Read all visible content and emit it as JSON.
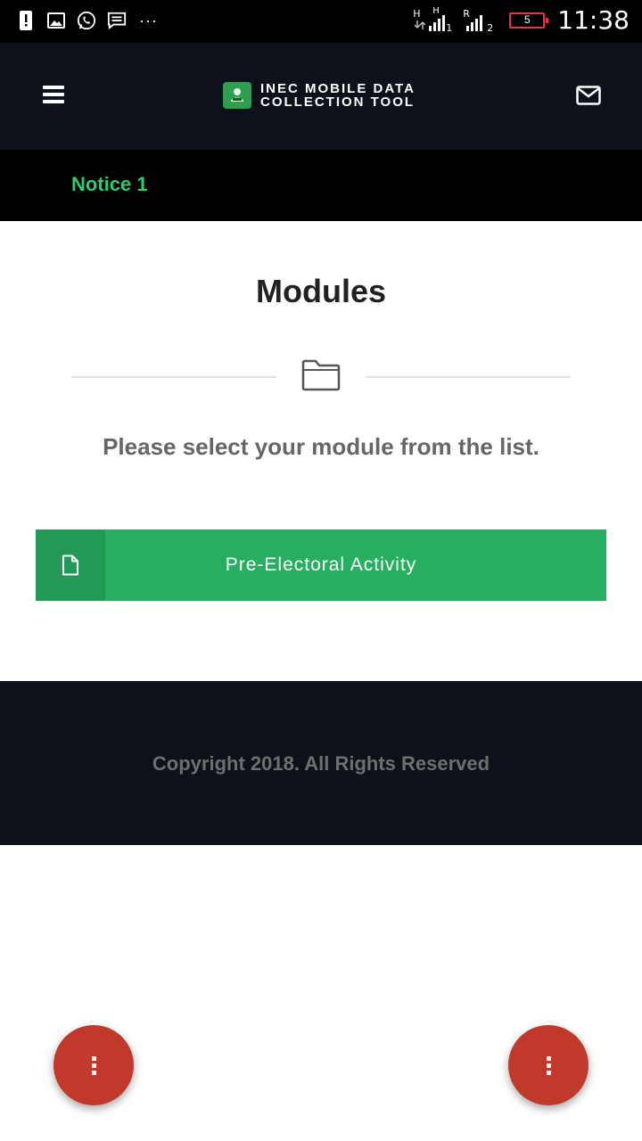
{
  "status_bar": {
    "time": "11:38",
    "battery_level": "5",
    "signal1_label_top": "H",
    "signal1_label_sub": "H",
    "signal1_slot": "1",
    "signal2_label_top": "R",
    "signal2_slot": "2",
    "overflow": "···",
    "icons": [
      "alert-icon",
      "image-icon",
      "whatsapp-icon",
      "message-icon"
    ]
  },
  "header": {
    "brand_line1": "INEC MOBILE DATA",
    "brand_line2": "COLLECTION TOOL",
    "menu_icon": "hamburger-icon",
    "mail_icon": "envelope-icon"
  },
  "notice": {
    "label": "Notice 1"
  },
  "main": {
    "title": "Modules",
    "divider_icon": "folder-icon",
    "subtitle": "Please select your module from the list.",
    "modules": [
      {
        "label": "Pre-Electoral Activity",
        "icon": "file-icon"
      }
    ]
  },
  "footer": {
    "copyright": "Copyright 2018. All Rights Reserved"
  },
  "fabs": [
    "more-vert-icon",
    "more-vert-icon"
  ],
  "colors": {
    "header_bg": "#0c111a",
    "accent_green": "#27ae60",
    "notice_green": "#2ecc71",
    "fab_red": "#c0392b",
    "battery_red": "#e53935"
  }
}
